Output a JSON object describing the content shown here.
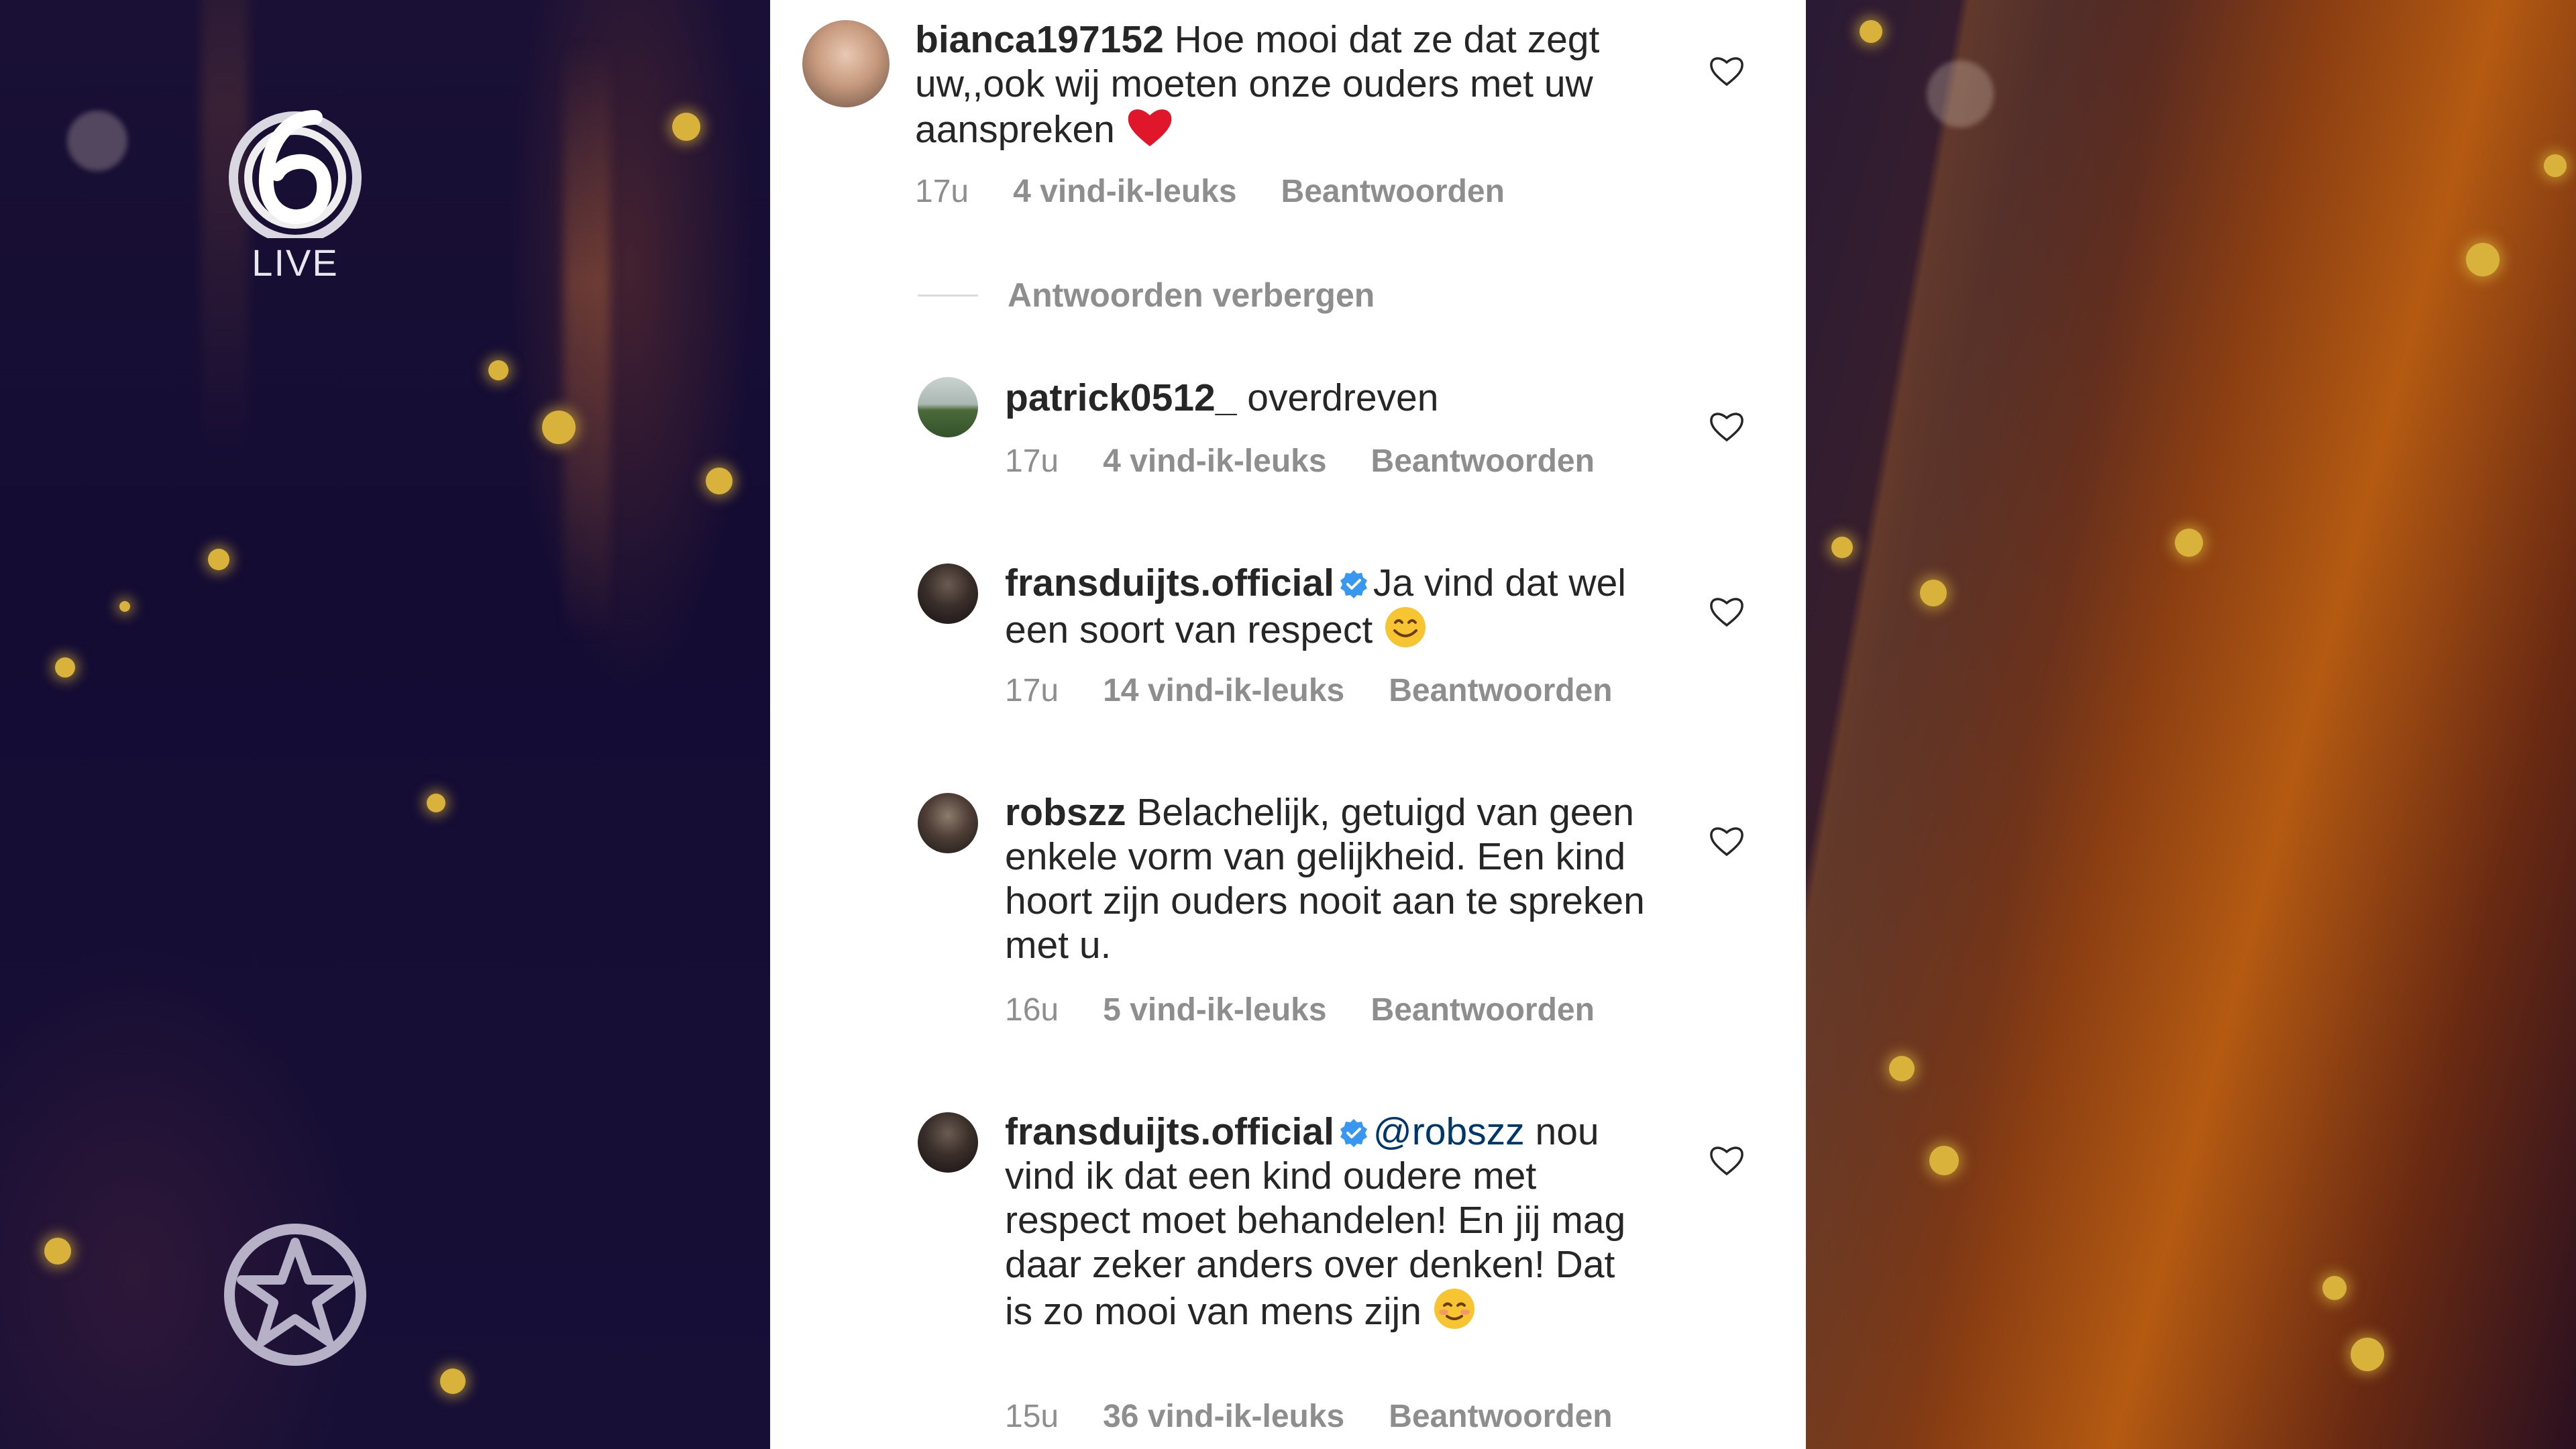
{
  "broadcast": {
    "channel_logo_label": "LIVE",
    "channel_number": "6"
  },
  "panel": {
    "hide_replies_label": "Antwoorden verbergen",
    "comments": [
      {
        "username": "bianca197152",
        "verified": false,
        "text": "Hoe mooi dat ze dat zegt uw,,ook wij moeten onze ouders met uw aanspreken",
        "emoji": "heart",
        "time": "17u",
        "likes": "4 vind-ik-leuks",
        "reply": "Beantwoorden"
      },
      {
        "username": "patrick0512_",
        "verified": false,
        "text": "overdreven",
        "time": "17u",
        "likes": "4 vind-ik-leuks",
        "reply": "Beantwoorden"
      },
      {
        "username": "fransduijts.official",
        "verified": true,
        "text": "Ja vind dat wel een soort van respect",
        "emoji": "smile",
        "time": "17u",
        "likes": "14 vind-ik-leuks",
        "reply": "Beantwoorden"
      },
      {
        "username": "robszz",
        "verified": false,
        "text": "Belachelijk, getuigd van geen enkele vorm van gelijkheid. Een kind hoort zijn ouders nooit aan te spreken met u.",
        "time": "16u",
        "likes": "5 vind-ik-leuks",
        "reply": "Beantwoorden"
      },
      {
        "username": "fransduijts.official",
        "verified": true,
        "mention": "@robszz",
        "text": "nou vind ik dat een kind oudere met respect moet behandelen! En jij mag daar zeker anders over denken! Dat is zo mooi van mens zijn",
        "emoji": "blush",
        "time": "15u",
        "likes": "36 vind-ik-leuks",
        "reply": "Beantwoorden"
      }
    ]
  },
  "colors": {
    "text": "#262626",
    "meta": "#8e8e8e",
    "mention": "#00376b",
    "verified": "#3897f0",
    "heart_emoji": "#e0172b"
  }
}
